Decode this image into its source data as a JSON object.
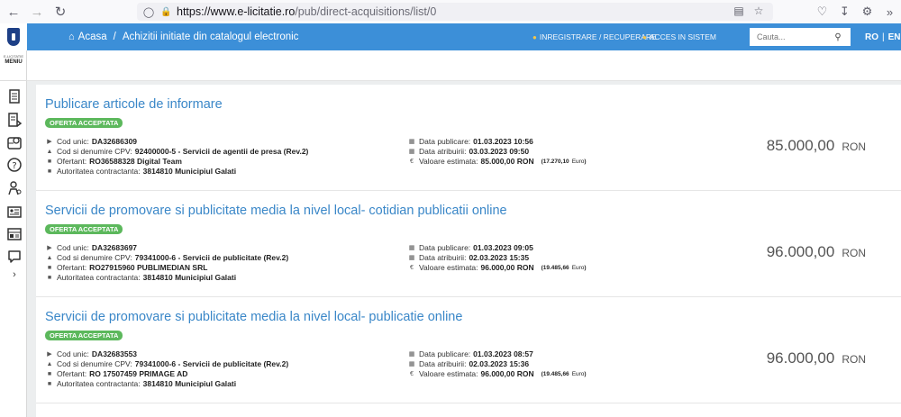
{
  "browser": {
    "url_host": "https://www.e-licitatie.ro",
    "url_path": "/pub/direct-acquisitions/list/0"
  },
  "header": {
    "breadcrumb_home": "Acasa",
    "breadcrumb_sep": "/",
    "breadcrumb_current": "Achizitii initiate din catalogul electronic",
    "register_link": "INREGISTRARE / RECUPERARE",
    "login_link": "ACCES IN SISTEM",
    "search_placeholder": "Cauta...",
    "lang_ro": "RO",
    "lang_sep": "|",
    "lang_en": "EN",
    "accent_color": "#3c8fd8"
  },
  "sidebar": {
    "label_small": "E-LICITATIE",
    "label": "MENIU",
    "icons": [
      "document-icon",
      "document-list-icon",
      "calendar-map-icon",
      "help-icon",
      "user-gear-icon",
      "id-card-icon",
      "dashboard-icon",
      "chat-icon"
    ]
  },
  "labels": {
    "cod_unic": "Cod unic:",
    "cod_cpv": "Cod si denumire CPV:",
    "ofertant": "Ofertant:",
    "autoritate": "Autoritatea contractanta:",
    "data_publicare": "Data publicare:",
    "data_atribuirii": "Data atribuirii:",
    "valoare": "Valoare estimata:",
    "euro_unit": "Euro"
  },
  "items": [
    {
      "title": "Publicare articole de informare",
      "status": "OFERTA ACCEPTATA",
      "cod_unic": "DA32686309",
      "cpv": "92400000-5 - Servicii de agentii de presa (Rev.2)",
      "ofertant": "RO36588328 Digital Team",
      "autoritate": "3814810 Municipiul Galati",
      "data_publicare": "01.03.2023 10:56",
      "data_atribuirii": "03.03.2023 09:50",
      "valoare": "85.000,00 RON",
      "valoare_euro": "(17.270,10",
      "euro_close": ")",
      "price": "85.000,00",
      "currency": "RON"
    },
    {
      "title": "Servicii de promovare si publicitate media la nivel local- cotidian publicatii online",
      "status": "OFERTA ACCEPTATA",
      "cod_unic": "DA32683697",
      "cpv": "79341000-6 - Servicii de publicitate (Rev.2)",
      "ofertant": "RO27915960 PUBLIMEDIAN SRL",
      "autoritate": "3814810 Municipiul Galati",
      "data_publicare": "01.03.2023 09:05",
      "data_atribuirii": "02.03.2023 15:35",
      "valoare": "96.000,00 RON",
      "valoare_euro": "(19.485,66",
      "euro_close": ")",
      "price": "96.000,00",
      "currency": "RON"
    },
    {
      "title": "Servicii de promovare si publicitate media la nivel local- publicatie online",
      "status": "OFERTA ACCEPTATA",
      "cod_unic": "DA32683553",
      "cpv": "79341000-6 - Servicii de publicitate (Rev.2)",
      "ofertant": "RO 17507459 PRIMAGE AD",
      "autoritate": "3814810 Municipiul Galati",
      "data_publicare": "01.03.2023 08:57",
      "data_atribuirii": "02.03.2023 15:36",
      "valoare": "96.000,00 RON",
      "valoare_euro": "(19.485,66",
      "euro_close": ")",
      "price": "96.000,00",
      "currency": "RON"
    }
  ]
}
